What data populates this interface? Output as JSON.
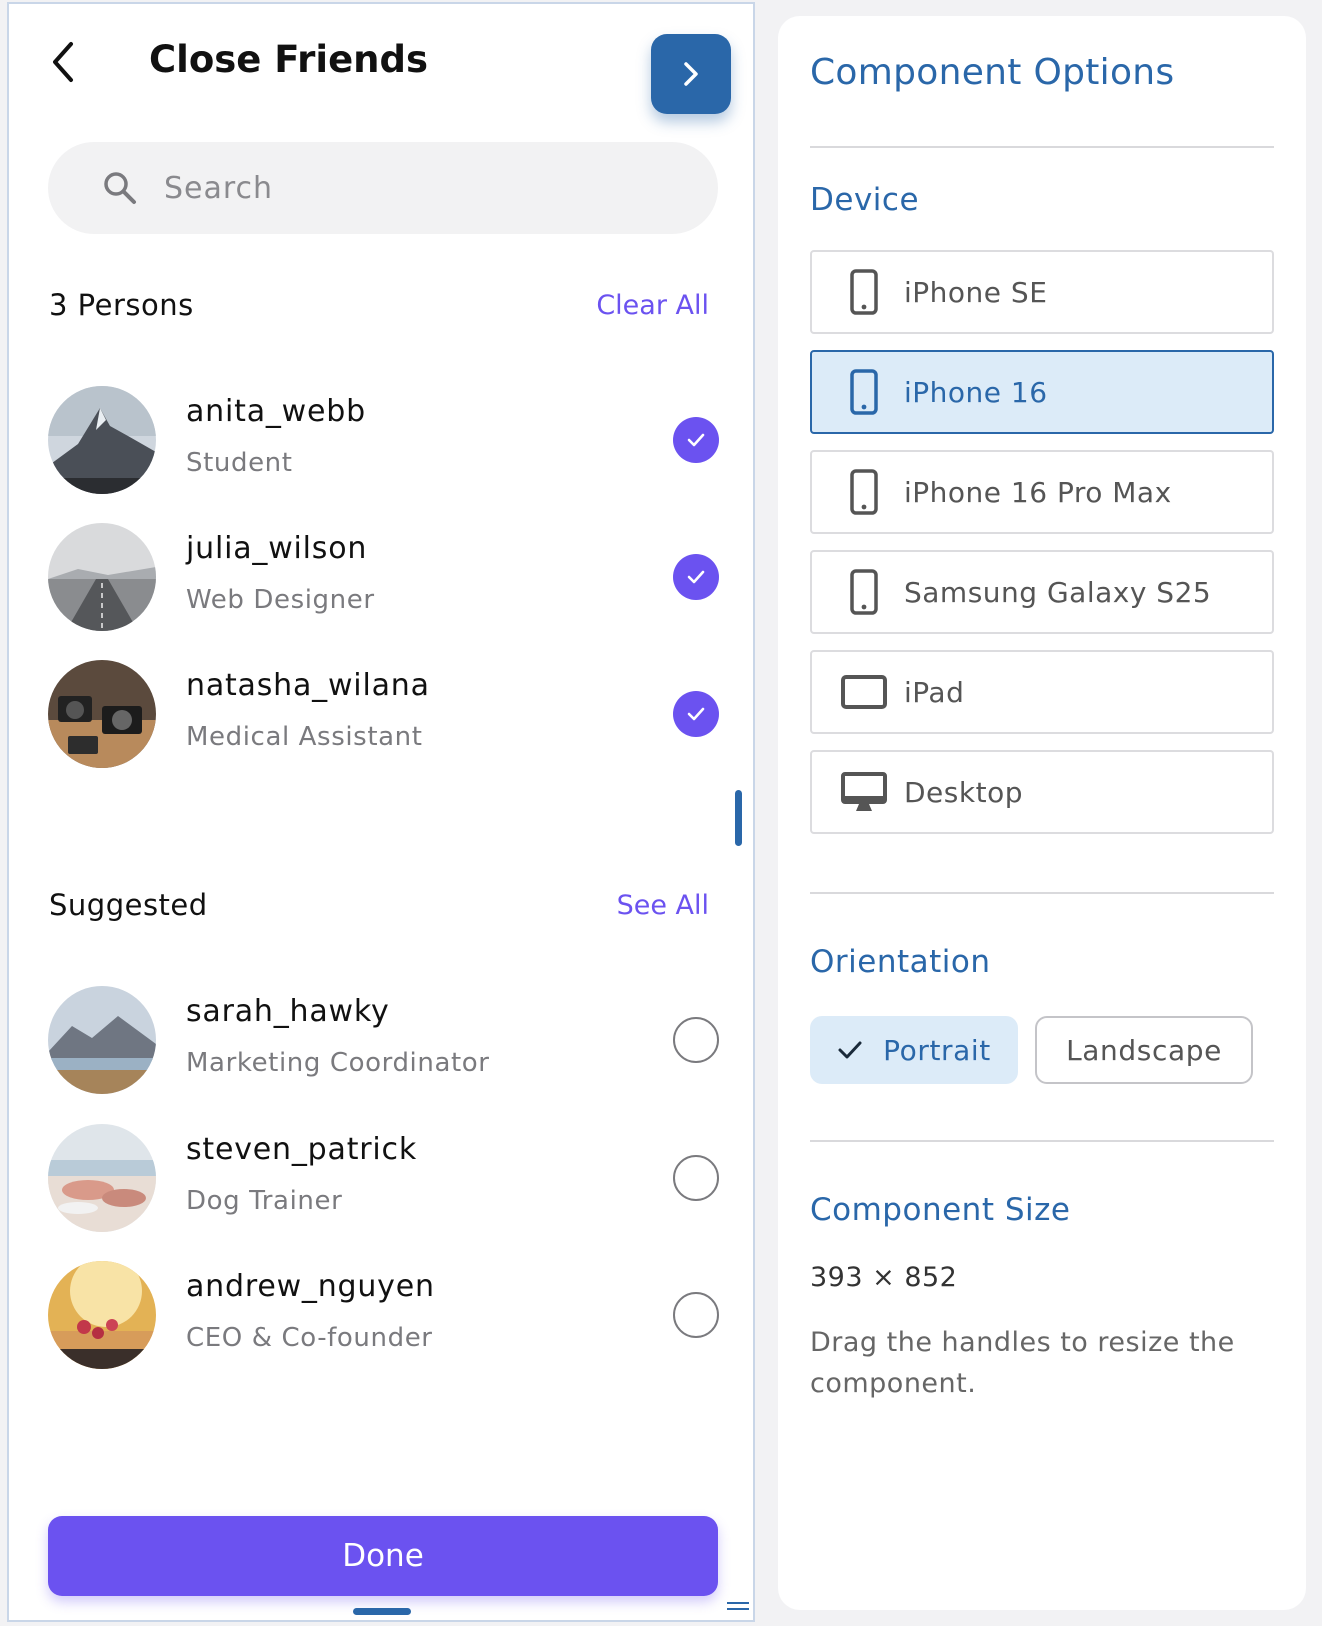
{
  "header": {
    "title": "Close Friends",
    "back_icon": "chevron-left-icon",
    "next_icon": "chevron-right-icon"
  },
  "search": {
    "placeholder": "Search",
    "value": ""
  },
  "selected_section": {
    "title": "3 Persons",
    "action": "Clear All",
    "people": [
      {
        "name": "anita_webb",
        "role": "Student",
        "checked": true
      },
      {
        "name": "julia_wilson",
        "role": "Web Designer",
        "checked": true
      },
      {
        "name": "natasha_wilana",
        "role": "Medical Assistant",
        "checked": true
      }
    ]
  },
  "suggested_section": {
    "title": "Suggested",
    "action": "See All",
    "people": [
      {
        "name": "sarah_hawky",
        "role": "Marketing Coordinator",
        "checked": false
      },
      {
        "name": "steven_patrick",
        "role": "Dog Trainer",
        "checked": false
      },
      {
        "name": "andrew_nguyen",
        "role": "CEO & Co-founder",
        "checked": false
      }
    ]
  },
  "done_label": "Done",
  "options": {
    "title": "Component Options",
    "device_heading": "Device",
    "devices": [
      {
        "label": "iPhone SE",
        "icon": "phone-icon",
        "selected": false
      },
      {
        "label": "iPhone 16",
        "icon": "phone-icon",
        "selected": true
      },
      {
        "label": "iPhone 16 Pro Max",
        "icon": "phone-icon",
        "selected": false
      },
      {
        "label": "Samsung Galaxy S25",
        "icon": "phone-icon",
        "selected": false
      },
      {
        "label": "iPad",
        "icon": "tablet-icon",
        "selected": false
      },
      {
        "label": "Desktop",
        "icon": "desktop-icon",
        "selected": false
      }
    ],
    "orientation_heading": "Orientation",
    "orientation": {
      "portrait": "Portrait",
      "landscape": "Landscape",
      "selected": "Portrait"
    },
    "size_heading": "Component Size",
    "size_value": "393 × 852",
    "size_help": "Drag the handles to resize the component."
  },
  "colors": {
    "accent_purple": "#6b52f0",
    "accent_blue": "#2a67a9",
    "selected_bg": "#dcebf8"
  }
}
